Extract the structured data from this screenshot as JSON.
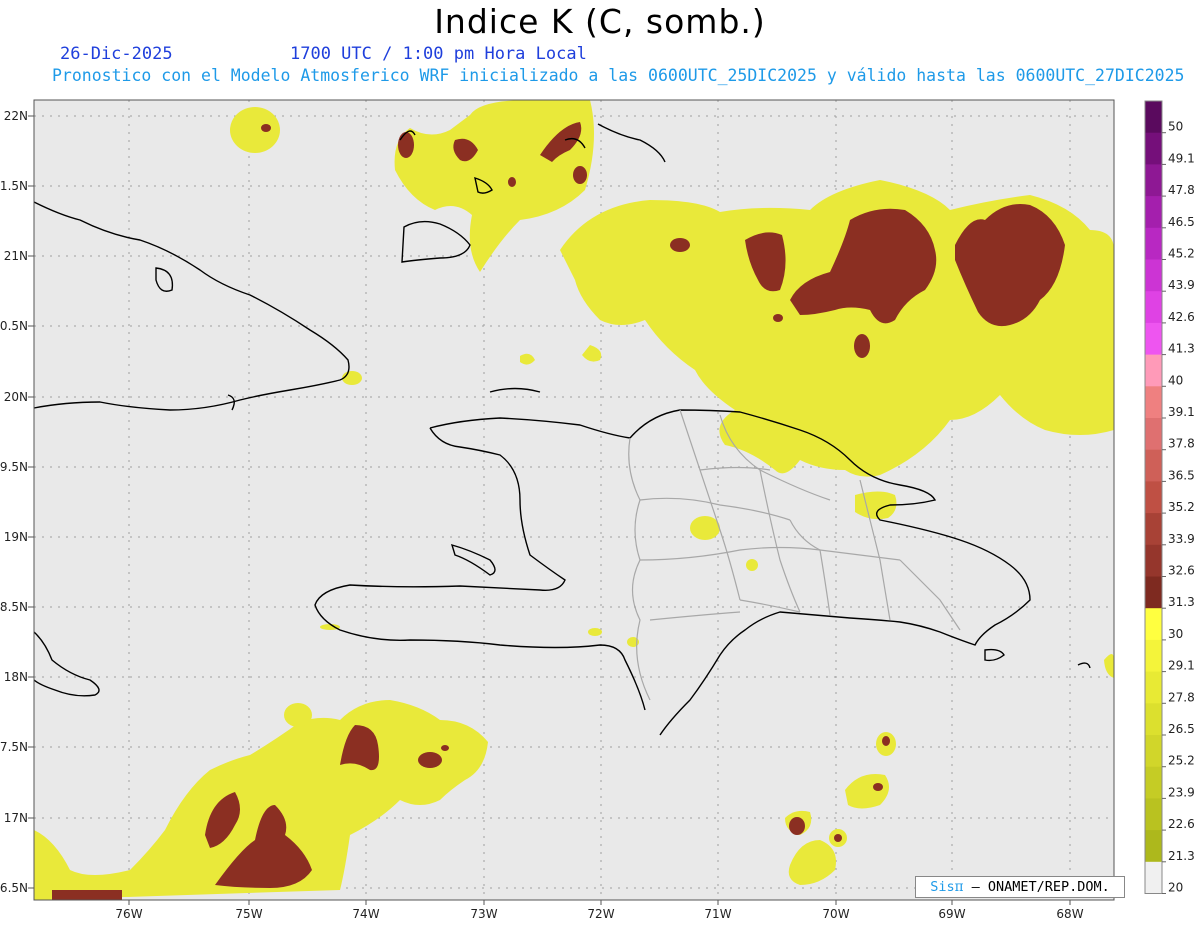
{
  "header": {
    "title": "Indice K (C, somb.)",
    "date": "26-Dic-2025",
    "time": "1700 UTC / 1:00 pm Hora Local",
    "subtitle": "Pronostico con el Modelo Atmosferico WRF inicializado a las 0600UTC_25DIC2025 y válido hasta las  0600UTC_27DIC2025"
  },
  "axes": {
    "lat_labels": [
      "22N",
      "21.5N",
      "21N",
      "20.5N",
      "20N",
      "19.5N",
      "19N",
      "18.5N",
      "18N",
      "17.5N",
      "17N",
      "16.5N"
    ],
    "lon_labels": [
      "76W",
      "75W",
      "74W",
      "73W",
      "72W",
      "71W",
      "70W",
      "69W",
      "68W"
    ]
  },
  "colorbar": {
    "labels": [
      "50",
      "49.1",
      "47.8",
      "46.5",
      "45.2",
      "43.9",
      "42.6",
      "41.3",
      "40",
      "39.1",
      "37.8",
      "36.5",
      "35.2",
      "33.9",
      "32.6",
      "31.3",
      "30",
      "29.1",
      "27.8",
      "26.5",
      "25.2",
      "23.9",
      "22.6",
      "21.3",
      "20"
    ],
    "colors": [
      "#5a0a5e",
      "#750f7a",
      "#8e1894",
      "#a41fad",
      "#b828c2",
      "#cc34d4",
      "#df42e4",
      "#ee55f0",
      "#ff9ab8",
      "#ef8080",
      "#df7070",
      "#cf6058",
      "#bf5044",
      "#a84236",
      "#95362c",
      "#7e2a20",
      "#ffff40",
      "#f4f43a",
      "#e8ea34",
      "#dce02e",
      "#d1d62a",
      "#c5cc25",
      "#b9c220",
      "#adb81c",
      "#f0f0f0"
    ]
  },
  "credit": {
    "logo": "Sis",
    "pi": "π",
    "text": " – ONAMET/REP.DOM."
  },
  "map": {
    "background": "#e9e9e9",
    "k_low_color": "#e9e93a",
    "k_high_color": "#8b2f22"
  }
}
